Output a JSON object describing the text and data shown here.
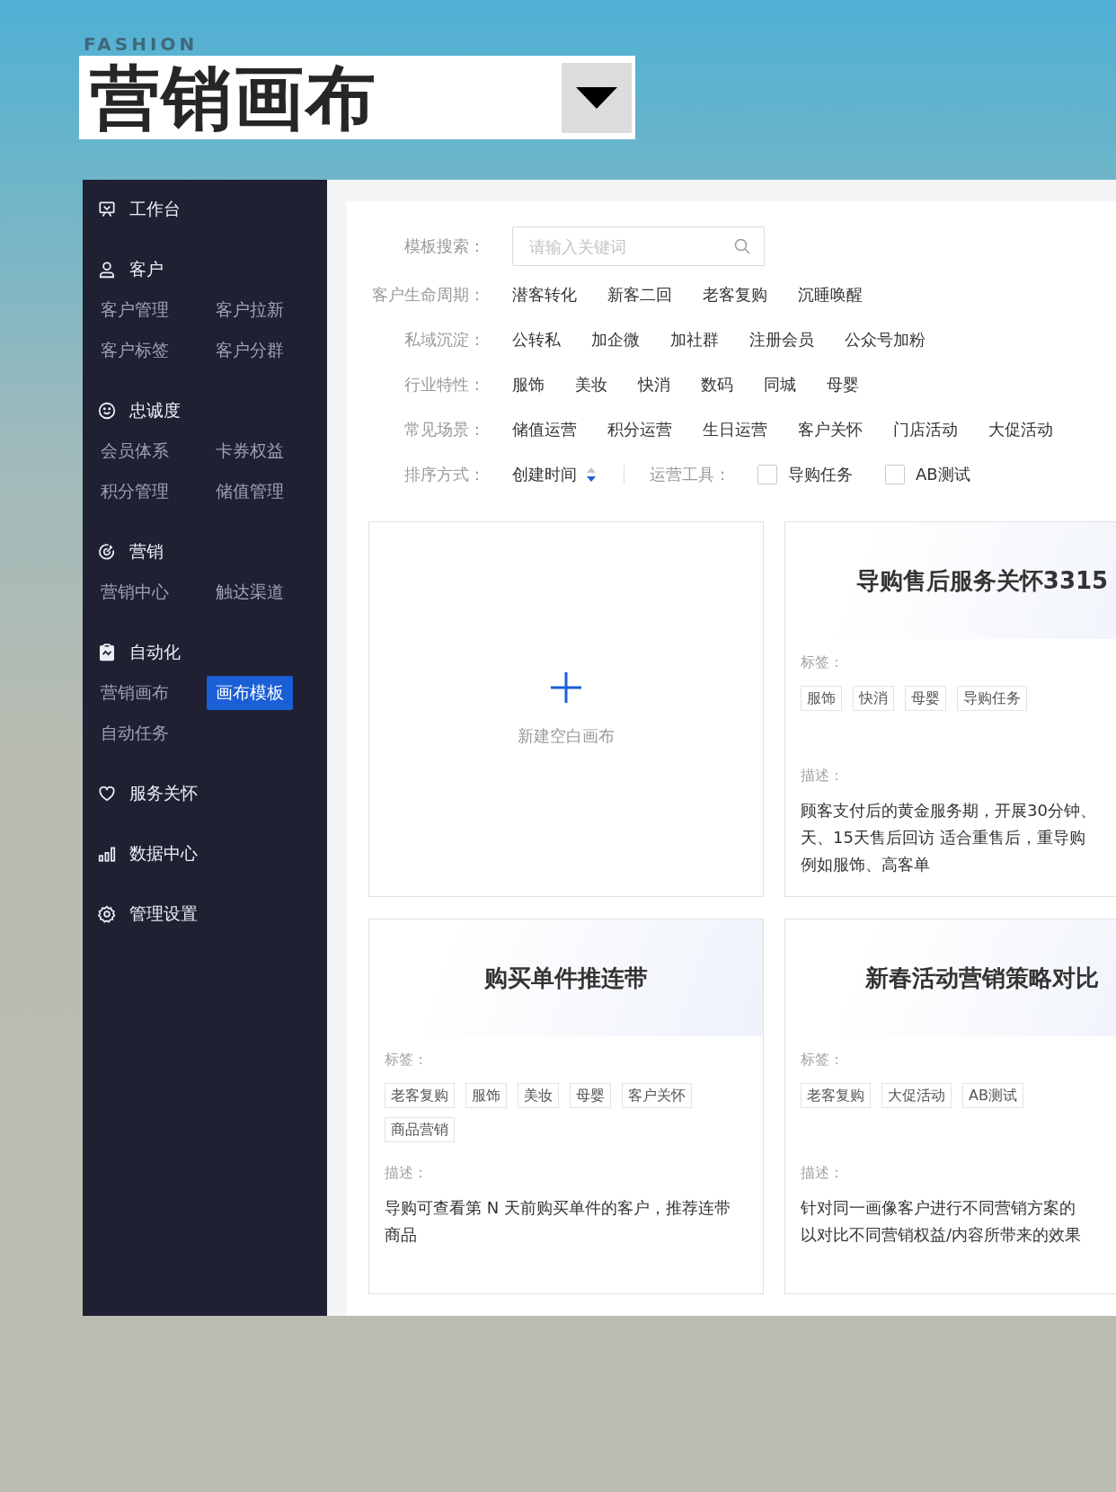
{
  "header": {
    "eyebrow": "FASHION",
    "title": "营销画布"
  },
  "sidebar": {
    "sections": [
      {
        "title": "工作台"
      },
      {
        "title": "客户",
        "items": [
          {
            "label": "客户管理",
            "selected": false
          },
          {
            "label": "客户拉新",
            "selected": false
          },
          {
            "label": "客户标签",
            "selected": false
          },
          {
            "label": "客户分群",
            "selected": false
          }
        ]
      },
      {
        "title": "忠诚度",
        "items": [
          {
            "label": "会员体系",
            "selected": false
          },
          {
            "label": "卡券权益",
            "selected": false
          },
          {
            "label": "积分管理",
            "selected": false
          },
          {
            "label": "储值管理",
            "selected": false
          }
        ]
      },
      {
        "title": "营销",
        "items": [
          {
            "label": "营销中心",
            "selected": false
          },
          {
            "label": "触达渠道",
            "selected": false
          }
        ]
      },
      {
        "title": "自动化",
        "items": [
          {
            "label": "营销画布",
            "selected": false
          },
          {
            "label": "画布模板",
            "selected": true
          },
          {
            "label": "自动任务",
            "selected": false
          }
        ]
      },
      {
        "title": "服务关怀"
      },
      {
        "title": "数据中心"
      },
      {
        "title": "管理设置"
      }
    ]
  },
  "filters": {
    "search": {
      "label": "模板搜索：",
      "placeholder": "请输入关键词"
    },
    "groups": [
      {
        "label": "客户生命周期：",
        "options": [
          "潜客转化",
          "新客二回",
          "老客复购",
          "沉睡唤醒"
        ]
      },
      {
        "label": "私域沉淀：",
        "options": [
          "公转私",
          "加企微",
          "加社群",
          "注册会员",
          "公众号加粉"
        ]
      },
      {
        "label": "行业特性：",
        "options": [
          "服饰",
          "美妆",
          "快消",
          "数码",
          "同城",
          "母婴"
        ]
      },
      {
        "label": "常见场景：",
        "options": [
          "储值运营",
          "积分运营",
          "生日运营",
          "客户关怀",
          "门店活动",
          "大促活动"
        ]
      }
    ],
    "sort": {
      "label": "排序方式：",
      "value": "创建时间"
    },
    "tools": {
      "label": "运营工具：",
      "options": [
        {
          "label": "导购任务",
          "checked": false
        },
        {
          "label": "AB测试",
          "checked": false
        }
      ]
    }
  },
  "cards": [
    {
      "kind": "new",
      "label": "新建空白画布"
    },
    {
      "kind": "template",
      "title": "导购售后服务关怀3315",
      "tags_label": "标签：",
      "tags": [
        "服饰",
        "快消",
        "母婴",
        "导购任务"
      ],
      "description_label": "描述：",
      "description_lines": [
        "顾客支付后的黄金服务期，开展30分钟、",
        "天、15天售后回访 适合重售后，重导购",
        "例如服饰、高客单"
      ]
    },
    {
      "kind": "template",
      "title": "购买单件推连带",
      "tags_label": "标签：",
      "tags": [
        "老客复购",
        "服饰",
        "美妆",
        "母婴",
        "客户关怀",
        "商品营销"
      ],
      "description_label": "描述：",
      "description": "导购可查看第 N 天前购买单件的客户，推荐连带商品"
    },
    {
      "kind": "template",
      "title": "新春活动营销策略对比",
      "tags_label": "标签：",
      "tags": [
        "老客复购",
        "大促活动",
        "AB测试"
      ],
      "description_label": "描述：",
      "description_lines": [
        "针对同一画像客户进行不同营销方案的",
        "以对比不同营销权益/内容所带来的效果"
      ]
    }
  ]
}
